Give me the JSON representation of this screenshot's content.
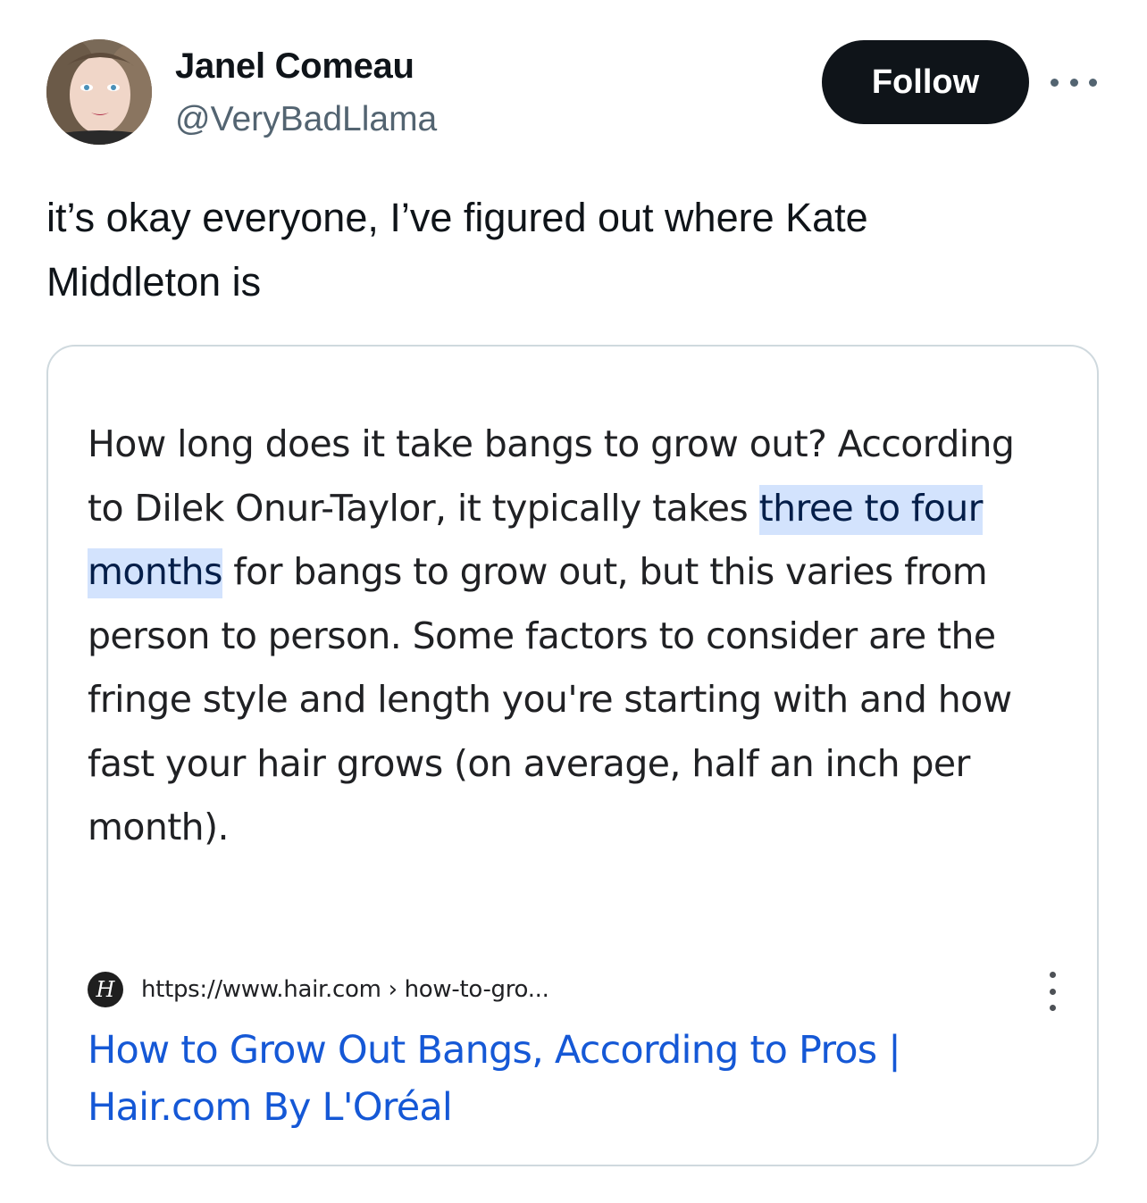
{
  "tweet": {
    "author": {
      "display_name": "Janel Comeau",
      "handle": "@VeryBadLlama",
      "avatar": "profile-photo"
    },
    "follow_label": "Follow",
    "more_icon": "more-horizontal-icon",
    "text_line1": "it’s okay everyone, I’ve figured out where Kate",
    "text_line2": "Middleton is"
  },
  "search_result": {
    "snippet_before": "How long does it take bangs to grow out? According to Dilek Onur-Taylor, it typically takes ",
    "snippet_highlight": "three to four months",
    "snippet_after": " for bangs to grow out, but this varies from person to person. Some factors to consider are the fringe style and length you're starting with and how fast your hair grows (on average, half an inch per month).",
    "favicon_letter": "H",
    "url": "https://www.hair.com › how-to-gro...",
    "title": "How to Grow Out Bangs, According to Pros | Hair.com By L'Oréal",
    "highlight_color": "#d3e3fd",
    "link_color": "#1558d6"
  }
}
